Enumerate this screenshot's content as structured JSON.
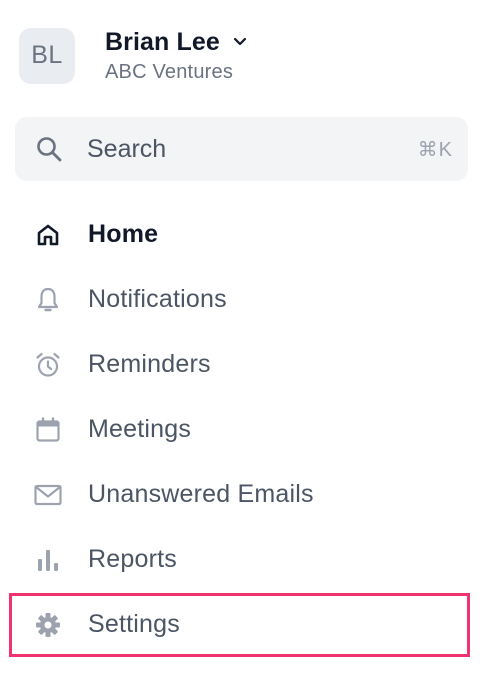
{
  "account": {
    "initials": "BL",
    "name": "Brian Lee",
    "organization": "ABC Ventures",
    "chevron_icon": "chevron-down-icon"
  },
  "search": {
    "placeholder": "Search",
    "shortcut": "⌘K",
    "icon": "search-icon"
  },
  "nav": {
    "items": [
      {
        "label": "Home",
        "icon": "home-icon",
        "active": true
      },
      {
        "label": "Notifications",
        "icon": "bell-icon",
        "active": false
      },
      {
        "label": "Reminders",
        "icon": "alarm-clock-icon",
        "active": false
      },
      {
        "label": "Meetings",
        "icon": "calendar-icon",
        "active": false
      },
      {
        "label": "Unanswered Emails",
        "icon": "envelope-icon",
        "active": false
      },
      {
        "label": "Reports",
        "icon": "bar-chart-icon",
        "active": false
      },
      {
        "label": "Settings",
        "icon": "gear-icon",
        "active": false,
        "highlighted": true
      }
    ]
  },
  "colors": {
    "text_primary": "#111827",
    "text_secondary": "#4b5563",
    "icon_gray": "#9ca3af",
    "search_bg": "#f3f4f6",
    "avatar_bg": "#e9ecf0",
    "highlight": "#f0326f"
  }
}
